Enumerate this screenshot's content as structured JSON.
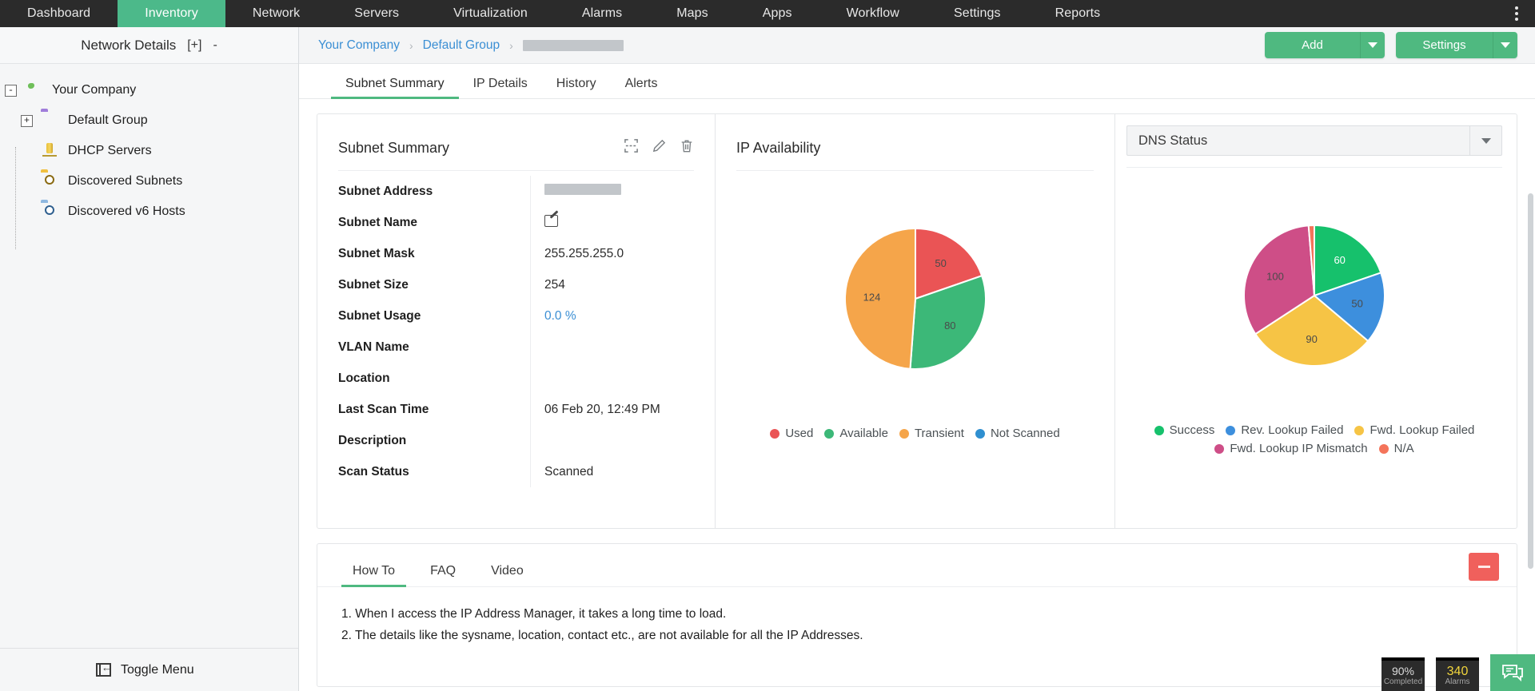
{
  "topnav": {
    "items": [
      {
        "label": "Dashboard",
        "active": false
      },
      {
        "label": "Inventory",
        "active": true
      },
      {
        "label": "Network",
        "active": false
      },
      {
        "label": "Servers",
        "active": false
      },
      {
        "label": "Virtualization",
        "active": false
      },
      {
        "label": "Alarms",
        "active": false
      },
      {
        "label": "Maps",
        "active": false
      },
      {
        "label": "Apps",
        "active": false
      },
      {
        "label": "Workflow",
        "active": false
      },
      {
        "label": "Settings",
        "active": false
      },
      {
        "label": "Reports",
        "active": false
      }
    ],
    "kebab": "more-options"
  },
  "left_panel": {
    "title": "Network Details",
    "expand_all": "[+]",
    "collapse_all": "-",
    "tree": [
      {
        "label": "Your Company",
        "toggle": "-",
        "icon": "globe-icon",
        "level": 1
      },
      {
        "label": "Default Group",
        "toggle": "+",
        "icon": "folder-icon",
        "level": 2
      },
      {
        "label": "DHCP Servers",
        "toggle": "",
        "icon": "dhcp-server-icon",
        "level": 2
      },
      {
        "label": "Discovered Subnets",
        "toggle": "",
        "icon": "search-folder-icon",
        "level": 2
      },
      {
        "label": "Discovered v6 Hosts",
        "toggle": "",
        "icon": "ipv6-folder-icon",
        "level": 2
      }
    ],
    "toggle_menu": "Toggle Menu"
  },
  "breadcrumb": {
    "items": [
      "Your Company",
      "Default Group"
    ],
    "redacted_item": "",
    "separator": "›"
  },
  "header_buttons": {
    "add": "Add",
    "settings": "Settings"
  },
  "tabs": [
    {
      "label": "Subnet Summary",
      "active": true
    },
    {
      "label": "IP Details",
      "active": false
    },
    {
      "label": "History",
      "active": false
    },
    {
      "label": "Alerts",
      "active": false
    }
  ],
  "subnet_summary": {
    "title": "Subnet Summary",
    "tools": [
      "fullscreen-icon",
      "edit-icon",
      "delete-icon"
    ],
    "rows": [
      {
        "key": "Subnet Address",
        "value": "",
        "type": "redacted"
      },
      {
        "key": "Subnet Name",
        "value": "",
        "type": "edit"
      },
      {
        "key": "Subnet Mask",
        "value": "255.255.255.0",
        "type": "text"
      },
      {
        "key": "Subnet Size",
        "value": "254",
        "type": "text"
      },
      {
        "key": "Subnet Usage",
        "value": "0.0 %",
        "type": "link"
      },
      {
        "key": "VLAN Name",
        "value": "",
        "type": "text"
      },
      {
        "key": "Location",
        "value": "",
        "type": "text"
      },
      {
        "key": "Last Scan Time",
        "value": "06 Feb 20, 12:49 PM",
        "type": "text"
      },
      {
        "key": "Description",
        "value": "",
        "type": "text"
      },
      {
        "key": "Scan Status",
        "value": "Scanned",
        "type": "text"
      }
    ]
  },
  "ip_availability": {
    "title": "IP Availability"
  },
  "dns_status": {
    "title": "DNS Status",
    "caret": "chevron-down-icon"
  },
  "help": {
    "tabs": [
      {
        "label": "How To",
        "active": true
      },
      {
        "label": "FAQ",
        "active": false
      },
      {
        "label": "Video",
        "active": false
      }
    ],
    "minimize": "minimize-button",
    "items": [
      "1. When I access the IP Address Manager, it takes a long time to load.",
      "2. The details like the sysname, location, contact etc., are not available for all the IP Addresses."
    ]
  },
  "floaters": {
    "completed_value": "90%",
    "completed_label": "Completed",
    "alarms_value": "340",
    "alarms_label": "Alarms",
    "chat": "chat-icon"
  },
  "chart_data": [
    {
      "type": "pie",
      "title": "IP Availability",
      "categories": [
        "Used",
        "Available",
        "Transient",
        "Not Scanned"
      ],
      "values": [
        50,
        80,
        124,
        0
      ],
      "colors": [
        "#ea5455",
        "#3cb878",
        "#f5a54a",
        "#2f8fd0"
      ],
      "labels_shown": [
        "50",
        "80",
        "124"
      ],
      "legend_position": "bottom",
      "total": 254
    },
    {
      "type": "pie",
      "title": "DNS Status",
      "categories": [
        "Success",
        "Rev. Lookup Failed",
        "Fwd. Lookup Failed",
        "Fwd. Lookup IP Mismatch",
        "N/A"
      ],
      "values": [
        60,
        50,
        90,
        100,
        4
      ],
      "colors": [
        "#16c16c",
        "#3d8fdd",
        "#f6c445",
        "#ce4e87",
        "#f4745a"
      ],
      "labels_shown": [
        "60",
        "50",
        "90",
        "100"
      ],
      "legend_position": "bottom",
      "total": 304
    }
  ]
}
